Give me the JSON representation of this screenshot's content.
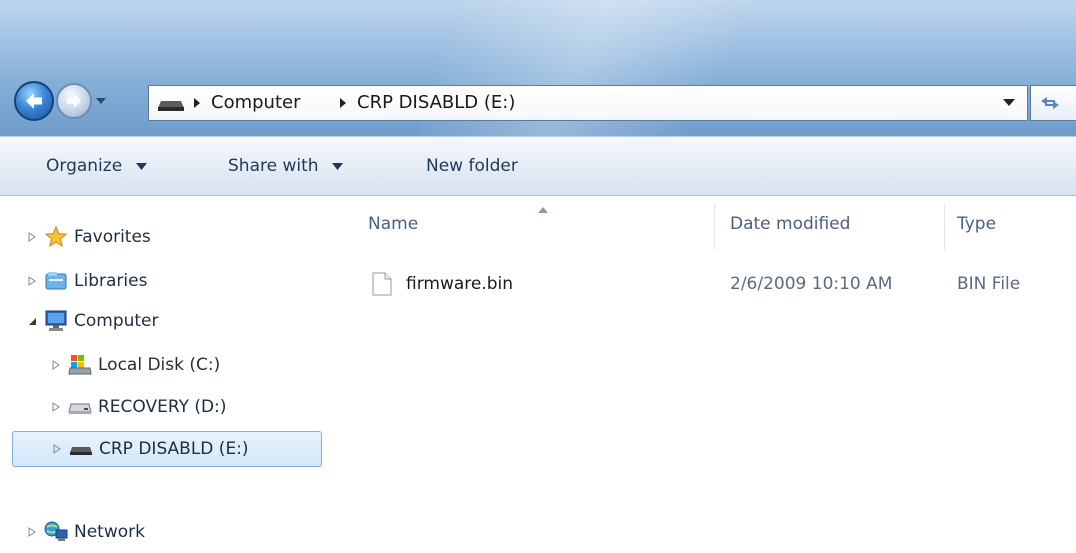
{
  "address": {
    "crumbs": [
      "Computer",
      "CRP DISABLD (E:)"
    ]
  },
  "toolbar": {
    "organize_label": "Organize",
    "share_label": "Share with",
    "newfolder_label": "New folder"
  },
  "navigation": {
    "items": [
      {
        "label": "Favorites",
        "icon": "star-icon",
        "expander": "collapsed"
      },
      {
        "label": "Libraries",
        "icon": "libraries-icon",
        "expander": "collapsed"
      },
      {
        "label": "Computer",
        "icon": "computer-icon",
        "expander": "expanded"
      },
      {
        "label": "Local Disk (C:)",
        "icon": "local-disk-icon",
        "expander": "collapsed"
      },
      {
        "label": "RECOVERY (D:)",
        "icon": "drive-icon",
        "expander": "collapsed"
      },
      {
        "label": "CRP DISABLD (E:)",
        "icon": "removable-drive-icon",
        "expander": "collapsed",
        "selected": true
      },
      {
        "label": "Network",
        "icon": "network-icon",
        "expander": "collapsed"
      }
    ]
  },
  "filelist": {
    "columns": [
      "Name",
      "Date modified",
      "Type"
    ],
    "sort_column": "Name",
    "rows": [
      {
        "name": "firmware.bin",
        "date": "2/6/2009 10:10 AM",
        "type": "BIN File",
        "icon": "file-icon"
      }
    ]
  },
  "colors": {
    "titlebar": "#85afd8",
    "selection_border": "#84acdd",
    "text": "#1e3a56"
  }
}
